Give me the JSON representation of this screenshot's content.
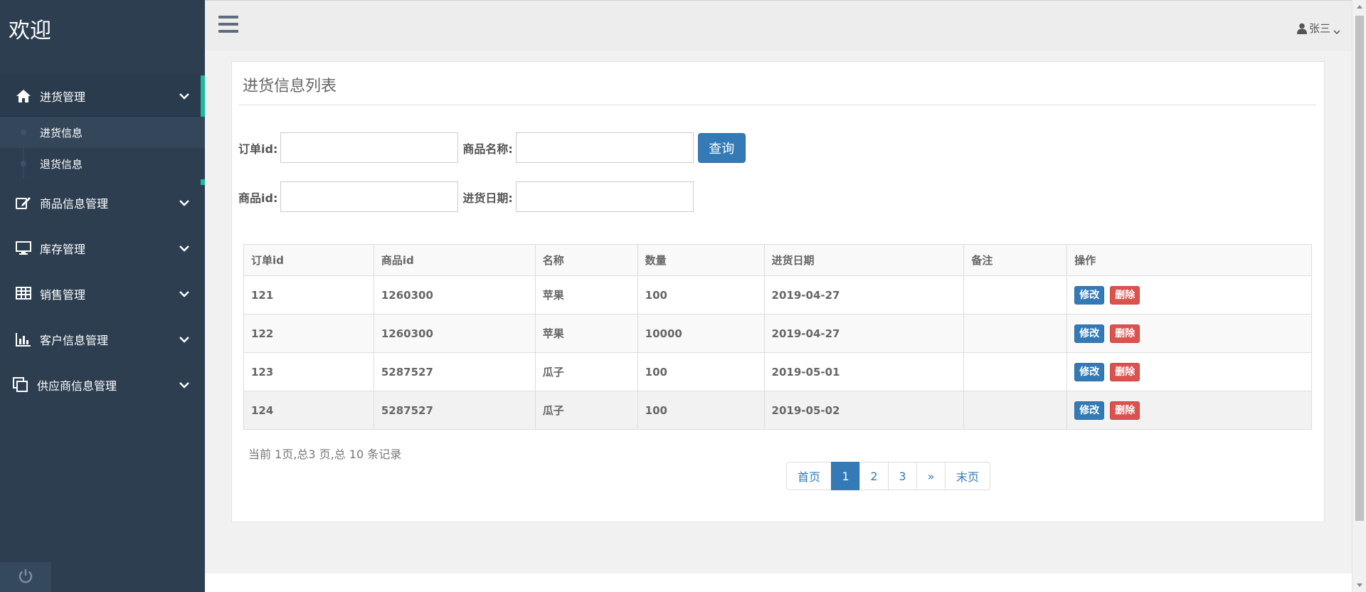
{
  "brand": {
    "title": "欢迎"
  },
  "sidebar": {
    "items": [
      {
        "label": "进货管理",
        "icon": "home-icon",
        "expanded": true,
        "children": [
          {
            "label": "进货信息"
          },
          {
            "label": "退货信息"
          }
        ]
      },
      {
        "label": "商品信息管理",
        "icon": "edit-icon"
      },
      {
        "label": "库存管理",
        "icon": "monitor-icon"
      },
      {
        "label": "销售管理",
        "icon": "table-icon"
      },
      {
        "label": "客户信息管理",
        "icon": "bar-chart-icon"
      },
      {
        "label": "供应商信息管理",
        "icon": "copy-icon"
      }
    ],
    "accent_color": "#1abc9c"
  },
  "topbar": {
    "user_name": "张三"
  },
  "panel": {
    "title": "进货信息列表",
    "form": {
      "order_id_label": "订单id:",
      "product_name_label": "商品名称:",
      "product_id_label": "商品id:",
      "purchase_date_label": "进货日期:",
      "query_button": "查询",
      "order_id_value": "",
      "product_name_value": "",
      "product_id_value": "",
      "purchase_date_value": ""
    },
    "table": {
      "headers": [
        "订单id",
        "商品id",
        "名称",
        "数量",
        "进货日期",
        "备注",
        "操作"
      ],
      "rows": [
        [
          "121",
          "1260300",
          "苹果",
          "100",
          "2019-04-27",
          ""
        ],
        [
          "122",
          "1260300",
          "苹果",
          "10000",
          "2019-04-27",
          ""
        ],
        [
          "123",
          "5287527",
          "瓜子",
          "100",
          "2019-05-01",
          ""
        ],
        [
          "124",
          "5287527",
          "瓜子",
          "100",
          "2019-05-02",
          ""
        ]
      ],
      "edit_label": "修改",
      "delete_label": "删除"
    },
    "page_info": "当前 1页,总3 页,总 10 条记录",
    "pagination": {
      "first": "首页",
      "pages": [
        "1",
        "2",
        "3"
      ],
      "next": "»",
      "last": "末页",
      "current": "1"
    }
  }
}
